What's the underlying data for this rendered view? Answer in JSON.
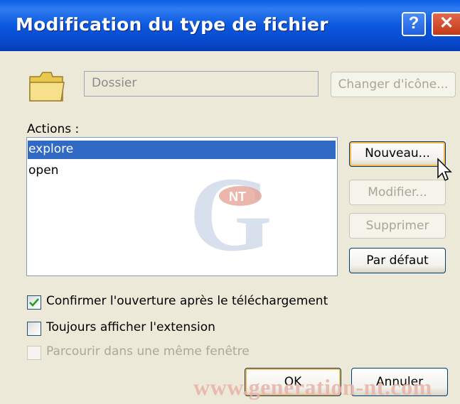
{
  "window": {
    "title": "Modification du type de fichier"
  },
  "titlebar_buttons": {
    "help": "?",
    "close": "✕"
  },
  "file_type": {
    "description": "Dossier",
    "change_icon_label": "Changer d'icône..."
  },
  "actions": {
    "label": "Actions :",
    "items": [
      "explore",
      "open"
    ],
    "selected_index": 0
  },
  "buttons": {
    "new": "Nouveau...",
    "edit": "Modifier...",
    "delete": "Supprimer",
    "default": "Par défaut",
    "ok": "OK",
    "cancel": "Annuler"
  },
  "options": [
    {
      "label": "Confirmer l'ouverture après le téléchargement",
      "checked": true,
      "enabled": true
    },
    {
      "label": "Toujours afficher l'extension",
      "checked": false,
      "enabled": true
    },
    {
      "label": "Parcourir dans une même fenêtre",
      "checked": false,
      "enabled": false
    }
  ],
  "watermark": {
    "text": "www.generation-nt.com"
  },
  "colors": {
    "selection": "#316ac5",
    "titlebar": "#0b58de",
    "dialog_bg": "#ece9d8"
  }
}
